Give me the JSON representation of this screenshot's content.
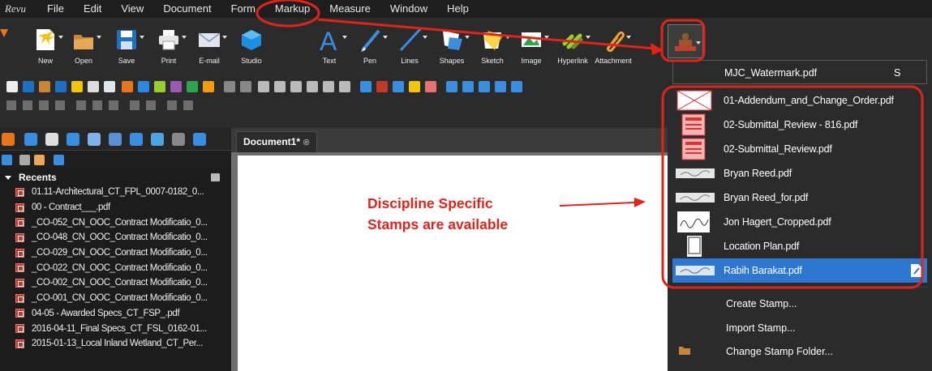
{
  "app": {
    "logo": "Revu"
  },
  "menu": [
    "File",
    "Edit",
    "View",
    "Document",
    "Form",
    "Markup",
    "Measure",
    "Window",
    "Help"
  ],
  "toolbar": {
    "tools": [
      "New",
      "Open",
      "Save",
      "Print",
      "E-mail",
      "Studio",
      "Text",
      "Pen",
      "Lines",
      "Shapes",
      "Sketch",
      "Image",
      "Hyperlink",
      "Attachment"
    ]
  },
  "left_panel": {
    "recents_label": "Recents",
    "recents": [
      "01.11-Architectural_CT_FPL_0007-0182_0...",
      "00 - Contract___.pdf",
      "_CO-052_CN_OOC_Contract Modificatio_0...",
      "_CO-048_CN_OOC_Contract Modificatio_0...",
      "_CO-029_CN_OOC_Contract Modificatio_0...",
      "_CO-022_CN_OOC_Contract Modificatio_0...",
      "_CO-002_CN_OOC_Contract Modificatio_0...",
      "_CO-001_CN_OOC_Contract Modificatio_0...",
      "04-05 - Awarded Specs_CT_FSP_.pdf",
      "2016-04-11_Final Specs_CT_FSL_0162-01...",
      "2015-01-13_Local Inland Wetland_CT_Per..."
    ]
  },
  "document": {
    "tab_title": "Document1*",
    "close_glyph": "⊗",
    "annotation_line1": "Discipline Specific",
    "annotation_line2": "Stamps are available"
  },
  "stamp_menu": {
    "current": "MJC_Watermark.pdf",
    "current_shortcut": "S",
    "items": [
      "01-Addendum_and_Change_Order.pdf",
      "02-Submittal_Review - 816.pdf",
      "02-Submittal_Review.pdf",
      "Bryan Reed.pdf",
      "Bryan Reed_for.pdf",
      "Jon Hagert_Cropped.pdf",
      "Location Plan.pdf",
      "Rabih Barakat.pdf"
    ],
    "selected_index": 7,
    "actions": [
      "Create Stamp...",
      "Import Stamp...",
      "Change Stamp Folder..."
    ]
  },
  "colors": {
    "highlight": "#e0231b",
    "selection": "#2d77d0",
    "background": "#2b2b2b"
  }
}
